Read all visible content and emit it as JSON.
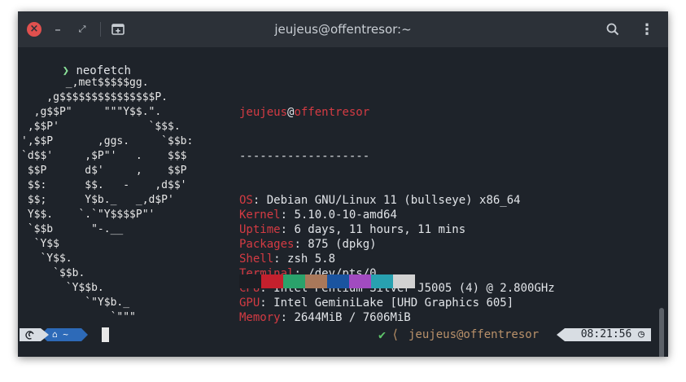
{
  "window": {
    "title": "jeujeus@offentresor:~"
  },
  "titlebar": {
    "close_glyph": "×",
    "min_glyph": "–",
    "max_glyph": "⤢",
    "newtab_icon": "new-tab-icon",
    "search_icon": "search-icon",
    "menu_glyph": "⋮"
  },
  "prompt": {
    "arrow": "❯",
    "command": "neofetch"
  },
  "logo": {
    "lines": [
      "       _,met$$$$$gg.",
      "    ,g$$$$$$$$$$$$$$$P.",
      "  ,g$$P\"     \"\"\"Y$$.\".",
      " ,$$P'              `$$$.",
      "',$$P       ,ggs.     `$$b:",
      "`d$$'     ,$P\"'   .    $$$",
      " $$P      d$'     ,    $$P",
      " $$:      $$.   -    ,d$$'",
      " $$;      Y$b._   _,d$P'",
      " Y$$.    `.`\"Y$$$$P\"'",
      " `$$b      \"-.__",
      "  `Y$$",
      "   `Y$$.",
      "     `$$b.",
      "       `Y$$b.",
      "          `\"Y$b._",
      "              `\"\"\""
    ]
  },
  "info": {
    "user": "jeujeus",
    "at": "@",
    "host": "offentresor",
    "separator": "-------------------",
    "rows": [
      {
        "key": "OS",
        "value": "Debian GNU/Linux 11 (bullseye) x86_64"
      },
      {
        "key": "Kernel",
        "value": "5.10.0-10-amd64"
      },
      {
        "key": "Uptime",
        "value": "6 days, 11 hours, 11 mins"
      },
      {
        "key": "Packages",
        "value": "875 (dpkg)"
      },
      {
        "key": "Shell",
        "value": "zsh 5.8"
      },
      {
        "key": "Terminal",
        "value": "/dev/pts/0"
      },
      {
        "key": "CPU",
        "value": "Intel Pentium Silver J5005 (4) @ 2.800GHz"
      },
      {
        "key": "GPU",
        "value": "Intel GeminiLake [UHD Graphics 605]"
      },
      {
        "key": "Memory",
        "value": "2644MiB / 7606MiB"
      }
    ]
  },
  "palette": [
    "#1b1e24",
    "#c4202d",
    "#2aa26b",
    "#a9785a",
    "#1a54a0",
    "#a14bc0",
    "#28a1b0",
    "#d2d2d2"
  ],
  "statusbar": {
    "os_icon": "debian-swirl-icon",
    "home_glyph": "⌂",
    "dir": "~",
    "status_check": "✔",
    "chevron": "⟨",
    "userhost": "jeujeus@offentresor",
    "time": "08:21:56",
    "clock_glyph": "◷"
  },
  "colors": {
    "terminal_bg": "#1e232a",
    "titlebar_bg": "#2c3138",
    "accent_red": "#d43b43",
    "dir_segment": "#2d6ab8"
  }
}
